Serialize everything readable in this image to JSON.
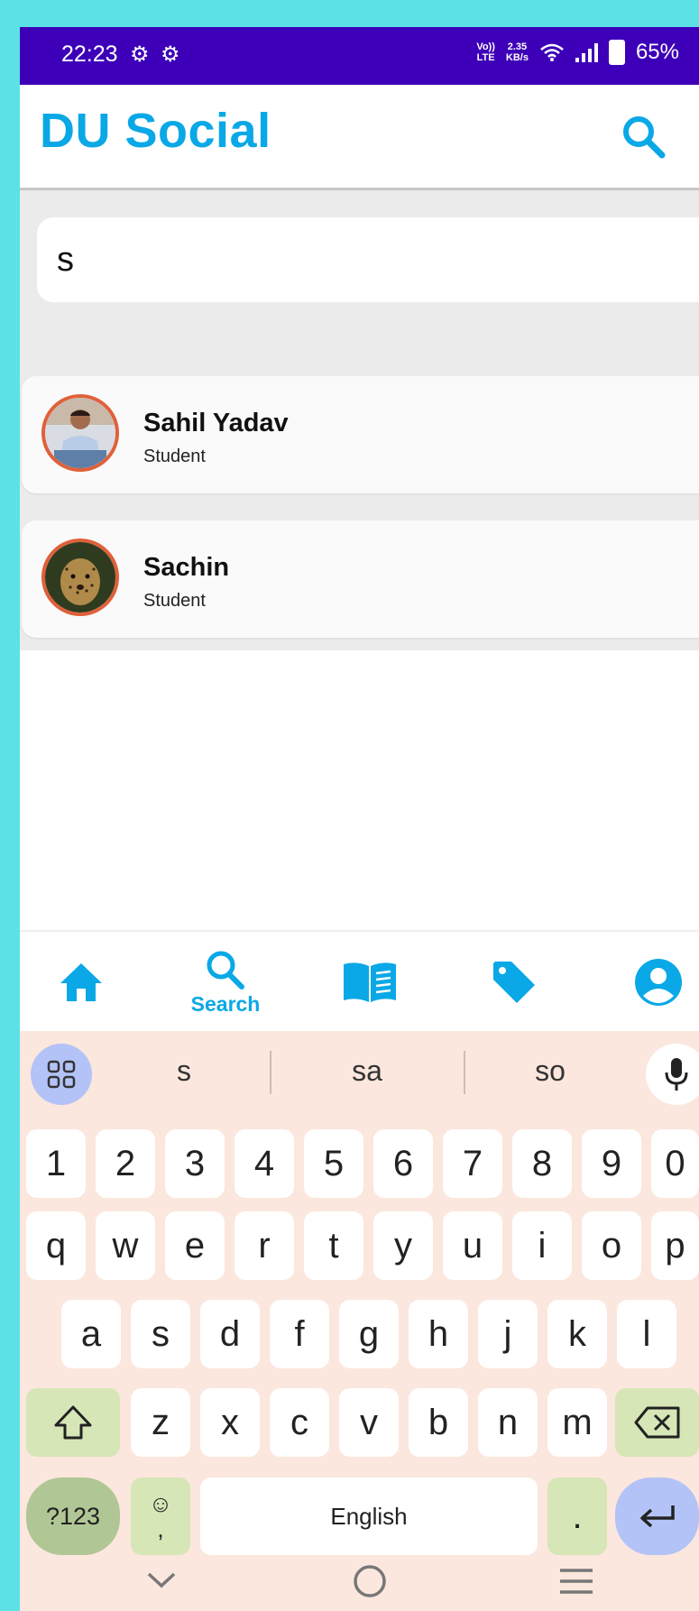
{
  "status_bar": {
    "time": "22:23",
    "network_top": "Vo))",
    "network_bottom": "LTE",
    "speed_top": "2.35",
    "speed_bottom": "KB/s",
    "battery": "65%"
  },
  "app": {
    "title": "DU Social"
  },
  "search": {
    "value": "s"
  },
  "results": [
    {
      "name": "Sahil Yadav",
      "role": "Student"
    },
    {
      "name": "Sachin",
      "role": "Student"
    }
  ],
  "bottom_nav": {
    "active_label": "Search"
  },
  "keyboard": {
    "suggestions": [
      "s",
      "sa",
      "so"
    ],
    "row_numbers": [
      "1",
      "2",
      "3",
      "4",
      "5",
      "6",
      "7",
      "8",
      "9",
      "0"
    ],
    "row1": [
      "q",
      "w",
      "e",
      "r",
      "t",
      "y",
      "u",
      "i",
      "o",
      "p"
    ],
    "row2": [
      "a",
      "s",
      "d",
      "f",
      "g",
      "h",
      "j",
      "k",
      "l"
    ],
    "row3": [
      "z",
      "x",
      "c",
      "v",
      "b",
      "n",
      "m"
    ],
    "symbols_label": "?123",
    "emoji_label": "☺",
    "comma_label": ",",
    "space_label": "English",
    "period_label": "."
  },
  "colors": {
    "accent": "#0aa8e6",
    "status_bar": "#3d00b8",
    "background": "#5ce1e6",
    "avatar_ring": "#e0603a"
  }
}
